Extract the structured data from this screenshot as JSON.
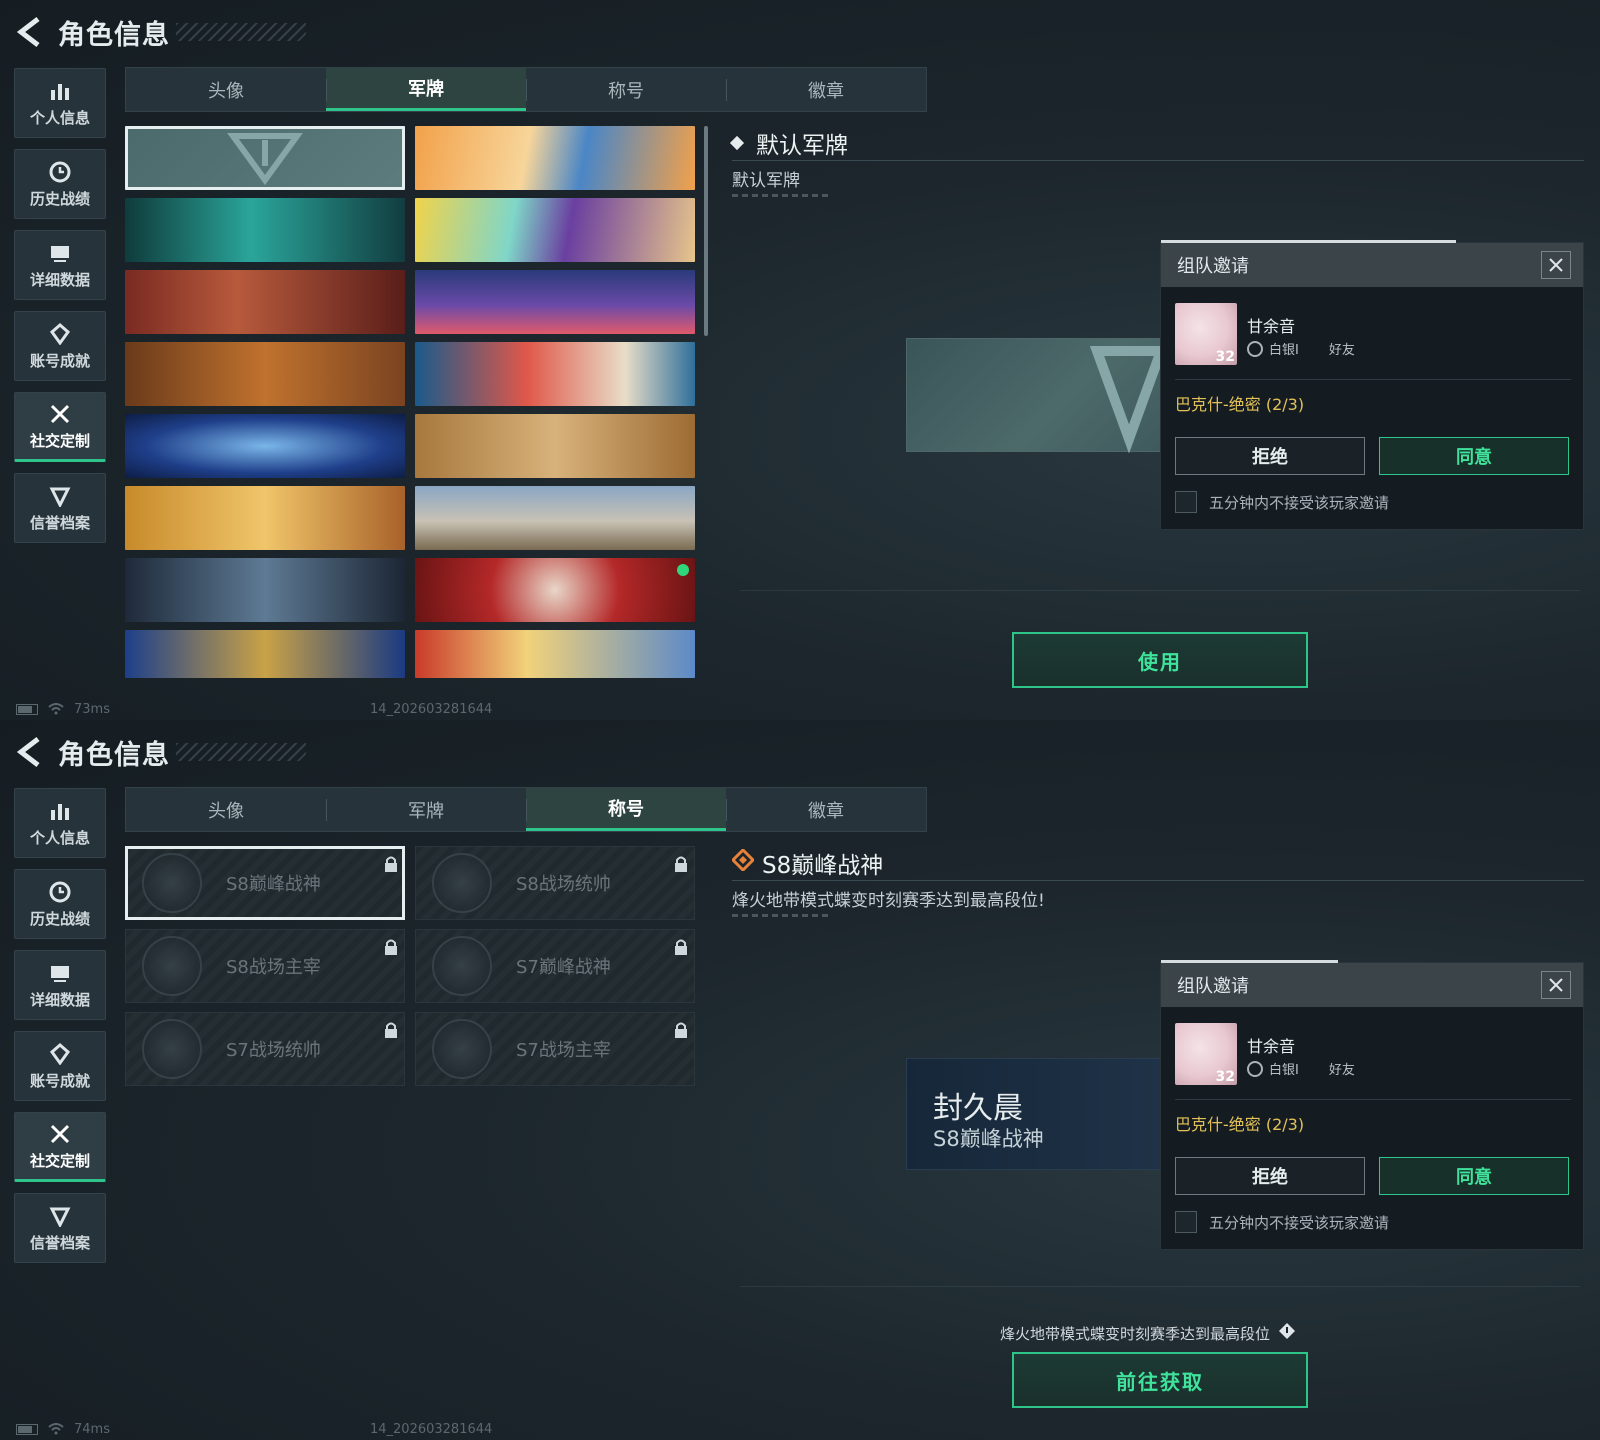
{
  "header": {
    "title": "角色信息"
  },
  "sidebar": {
    "items": [
      {
        "label": "个人信息",
        "icon": "bar-chart-icon"
      },
      {
        "label": "历史战绩",
        "icon": "history-clock-icon"
      },
      {
        "label": "详细数据",
        "icon": "data-card-icon"
      },
      {
        "label": "账号成就",
        "icon": "achievement-icon"
      },
      {
        "label": "社交定制",
        "icon": "tools-icon",
        "active": true
      },
      {
        "label": "信誉档案",
        "icon": "shield-badge-icon"
      }
    ]
  },
  "tabs": [
    "头像",
    "军牌",
    "称号",
    "徽章"
  ],
  "panel1": {
    "active_tab": "军牌",
    "detail_title": "默认军牌",
    "detail_desc": "默认军牌",
    "action": "使用"
  },
  "panel2": {
    "active_tab": "称号",
    "titles": [
      {
        "label": "S8巅峰战神",
        "locked": true,
        "selected": true
      },
      {
        "label": "S8战场统帅",
        "locked": true
      },
      {
        "label": "S8战场主宰",
        "locked": true
      },
      {
        "label": "S7巅峰战神",
        "locked": true
      },
      {
        "label": "S7战场统帅",
        "locked": true
      },
      {
        "label": "S7战场主宰",
        "locked": true
      }
    ],
    "detail_title": "S8巅峰战神",
    "detail_desc": "烽火地带模式蝶变时刻赛季达到最高段位!",
    "preview_name": "封久晨",
    "preview_title": "S8巅峰战神",
    "requirement": "烽火地带模式蝶变时刻赛季达到最高段位",
    "action": "前往获取"
  },
  "invite": {
    "title": "组队邀请",
    "player_name": "甘余音",
    "level": "32",
    "rank": "白银I",
    "relation": "好友",
    "mode": "巴克什-绝密 (2/3)",
    "reject": "拒绝",
    "accept": "同意",
    "mute_option": "五分钟内不接受该玩家邀请",
    "progress_panel1": 0.7,
    "progress_panel2": 0.42
  },
  "status1": {
    "ping": "73ms",
    "build": "14_202603281644"
  },
  "status2": {
    "ping": "74ms",
    "build": "14_202603281644"
  },
  "colors": {
    "accent": "#2fc58a",
    "accent_text": "#3fe39c",
    "mode_text": "#e3c25a"
  }
}
